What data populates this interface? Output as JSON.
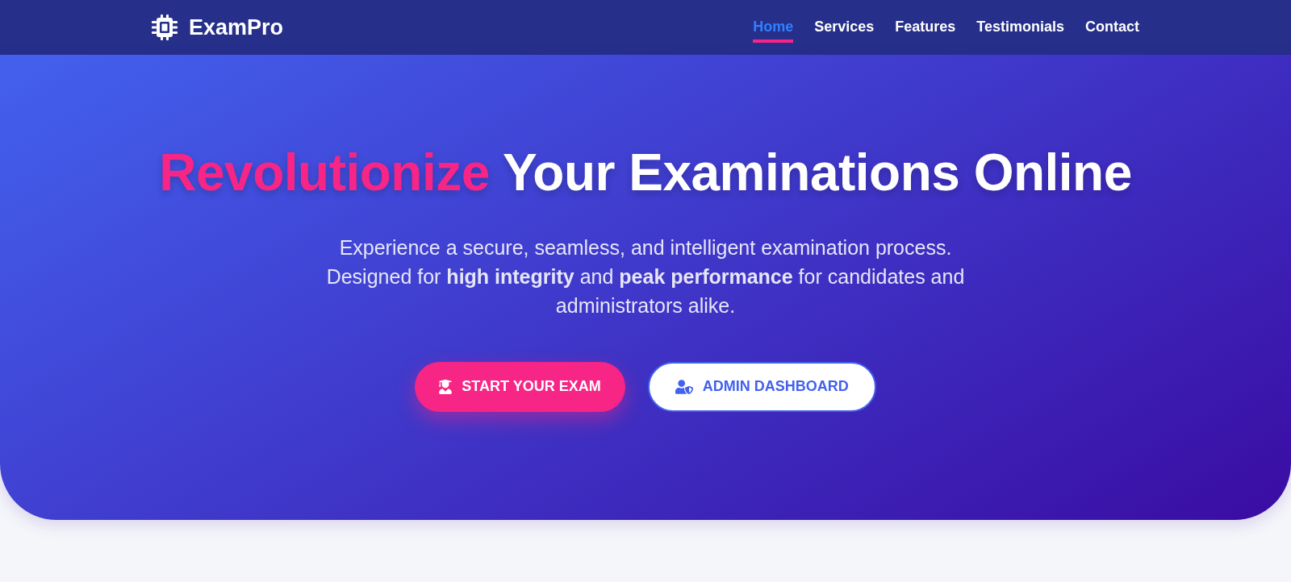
{
  "navbar": {
    "brand": "ExamPro",
    "links": [
      {
        "label": "Home",
        "selected": true
      },
      {
        "label": "Services",
        "selected": false
      },
      {
        "label": "Features",
        "selected": false
      },
      {
        "label": "Testimonials",
        "selected": false
      },
      {
        "label": "Contact",
        "selected": false
      }
    ]
  },
  "hero": {
    "heading": {
      "highlight": "Revolutionize",
      "rest": "Your Examinations Online"
    },
    "description": "Experience a secure, seamless, and intelligent examination process. Designed for **high integrity** and **peak performance** for candidates and administrators alike.",
    "buttons": [
      {
        "kind": "primary",
        "label": "START YOUR EXAM"
      },
      {
        "kind": "secondary",
        "label": "ADMIN DASHBOARD"
      }
    ]
  }
}
